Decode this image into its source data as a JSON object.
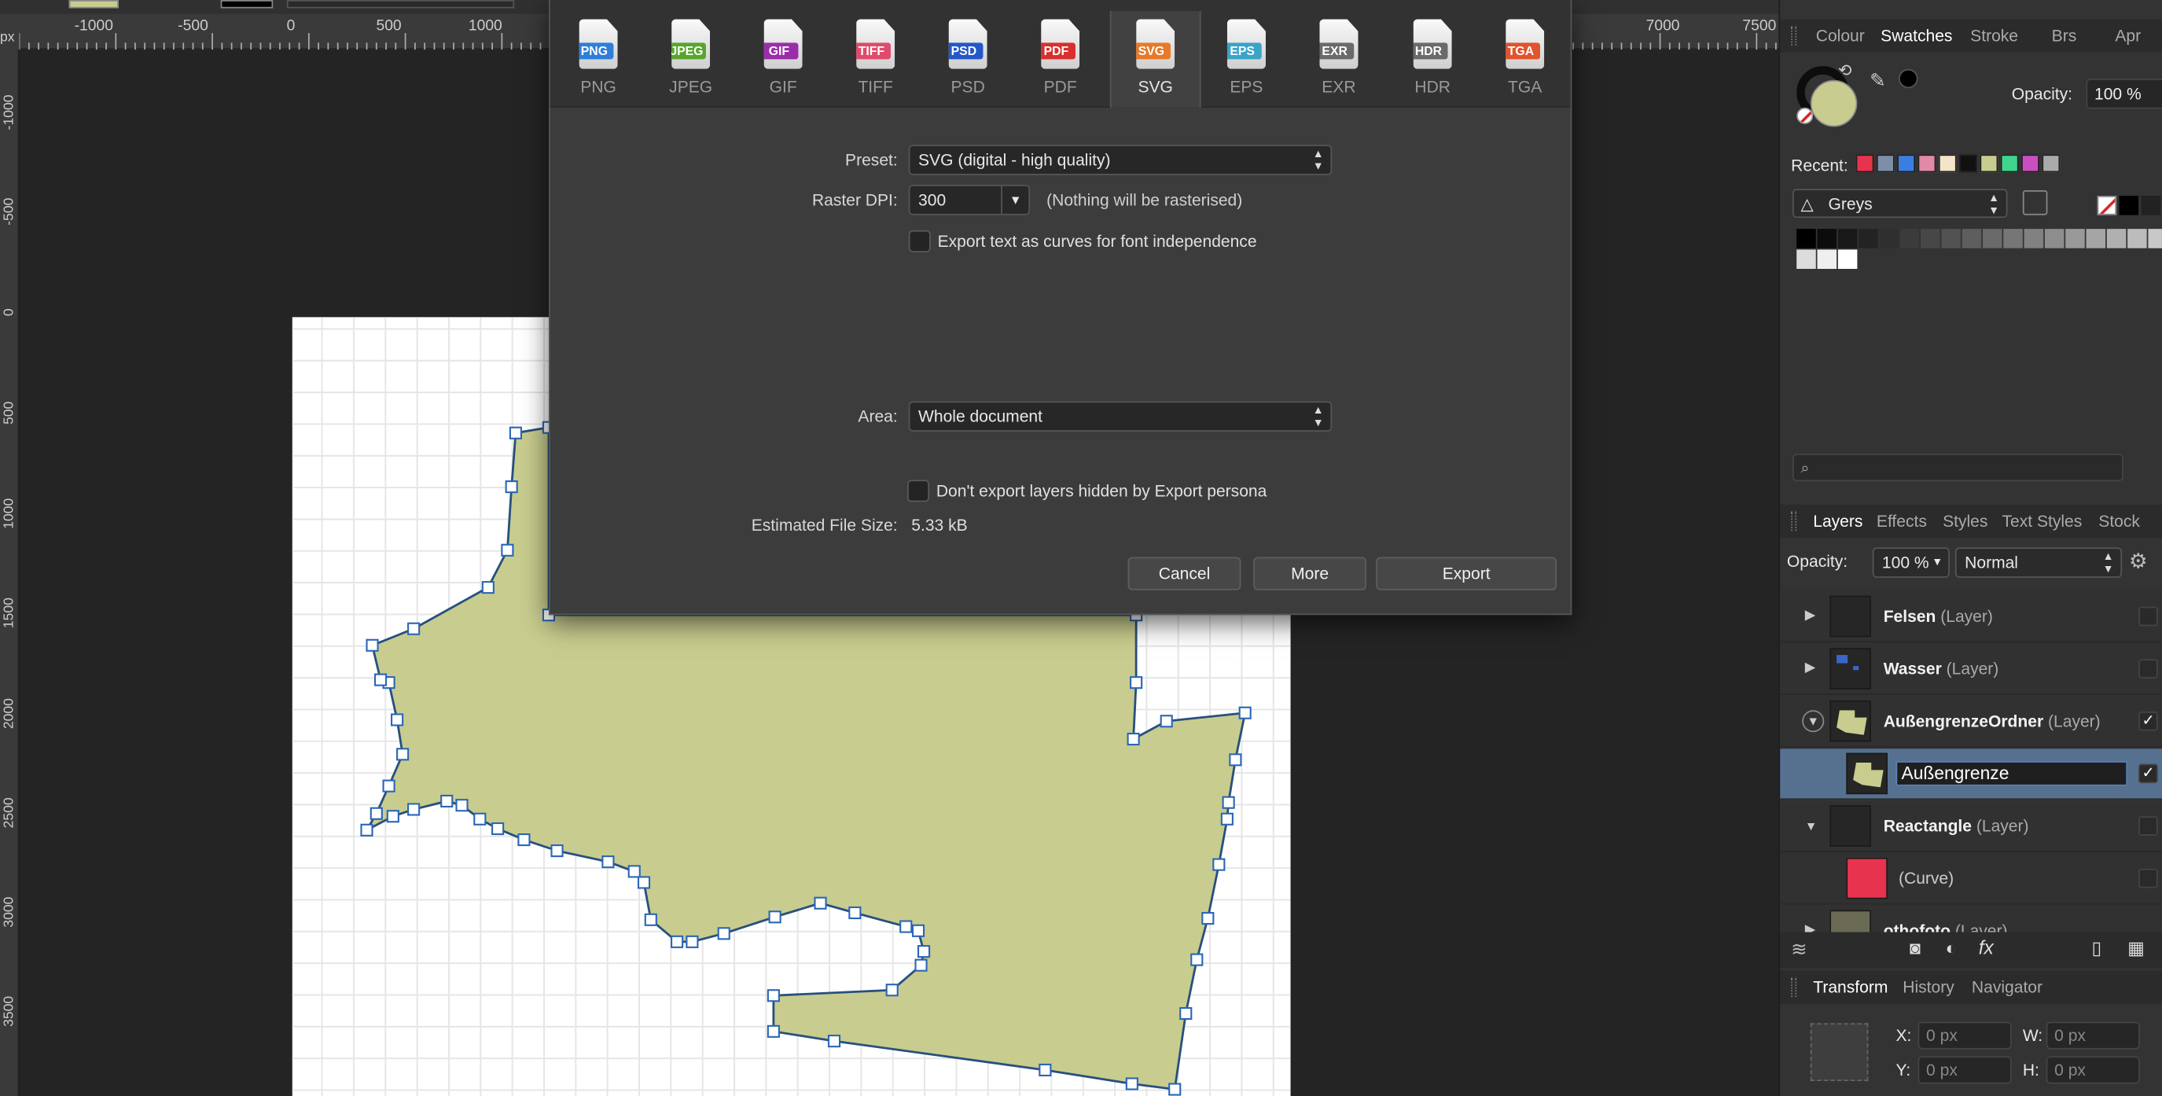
{
  "rulers": {
    "unit": "px",
    "h_ticks": [
      "-1000",
      "-500",
      "0",
      "500",
      "1000",
      "7000",
      "7500"
    ],
    "v_ticks": [
      "-1000",
      "-500",
      "0",
      "500",
      "1000",
      "1500",
      "2000",
      "2500",
      "3000",
      "3500"
    ]
  },
  "dialog": {
    "formats": [
      {
        "name": "PNG",
        "label": "PNG",
        "color": "#2f7fd8"
      },
      {
        "name": "JPEG",
        "label": "JPEG",
        "color": "#58a52e"
      },
      {
        "name": "GIF",
        "label": "GIF",
        "color": "#9a2ea8"
      },
      {
        "name": "TIFF",
        "label": "TIFF",
        "color": "#e04a6c"
      },
      {
        "name": "PSD",
        "label": "PSD",
        "color": "#2458c8"
      },
      {
        "name": "PDF",
        "label": "PDF",
        "color": "#d8302e"
      },
      {
        "name": "SVG",
        "label": "SVG",
        "color": "#e67a2a",
        "selected": true
      },
      {
        "name": "EPS",
        "label": "EPS",
        "color": "#3aa3c8"
      },
      {
        "name": "EXR",
        "label": "EXR",
        "color": "#6a6a6a"
      },
      {
        "name": "HDR",
        "label": "HDR",
        "color": "#6a6a6a"
      },
      {
        "name": "TGA",
        "label": "TGA",
        "color": "#e0542e"
      }
    ],
    "preset_label": "Preset:",
    "preset_value": "SVG (digital - high quality)",
    "dpi_label": "Raster DPI:",
    "dpi_value": "300",
    "dpi_note": "(Nothing will be rasterised)",
    "curves_label": "Export text as curves for font independence",
    "area_label": "Area:",
    "area_value": "Whole document",
    "hidden_label": "Don't export layers hidden by Export persona",
    "size_label": "Estimated File Size:",
    "size_value": "5.33 kB",
    "cancel": "Cancel",
    "more": "More",
    "export": "Export"
  },
  "panel": {
    "color_tabs": [
      "Colour",
      "Swatches",
      "Stroke",
      "Brs",
      "Apr"
    ],
    "color_active": "Swatches",
    "opacity_label": "Opacity:",
    "opacity_value": "100 %",
    "recent_label": "Recent:",
    "recent_colors": [
      "#e8334f",
      "#7d8fa8",
      "#3a7fe0",
      "#e08aa6",
      "#f4e4c8",
      "#111111",
      "#c8cc8e",
      "#3fd48c",
      "#c94fc0",
      "#aaaaaa"
    ],
    "palette_name": "Greys",
    "fill_color": "#c8cc8e",
    "layer_tabs": [
      "Layers",
      "Effects",
      "Styles",
      "Text Styles",
      "Stock"
    ],
    "layer_active": "Layers",
    "layer_opacity_label": "Opacity:",
    "layer_opacity_value": "100 %",
    "blend_mode": "Normal",
    "layers": [
      {
        "name": "Felsen",
        "type": "(Layer)"
      },
      {
        "name": "Wasser",
        "type": "(Layer)"
      },
      {
        "name": "AußengrenzeOrdner",
        "type": "(Layer)"
      },
      {
        "name": "Außengrenze",
        "type": ""
      },
      {
        "name": "Reactangle",
        "type": "(Layer)"
      },
      {
        "name": "",
        "type": "(Curve)"
      },
      {
        "name": "othofoto",
        "type": "(Layer)"
      }
    ],
    "transform_tabs": [
      "Transform",
      "History",
      "Navigator"
    ],
    "transform_active": "Transform",
    "x_label": "X:",
    "x_value": "0 px",
    "y_label": "Y:",
    "y_value": "0 px",
    "w_label": "W:",
    "w_value": "0 px",
    "h_label": "H:",
    "h_value": "0 px"
  }
}
